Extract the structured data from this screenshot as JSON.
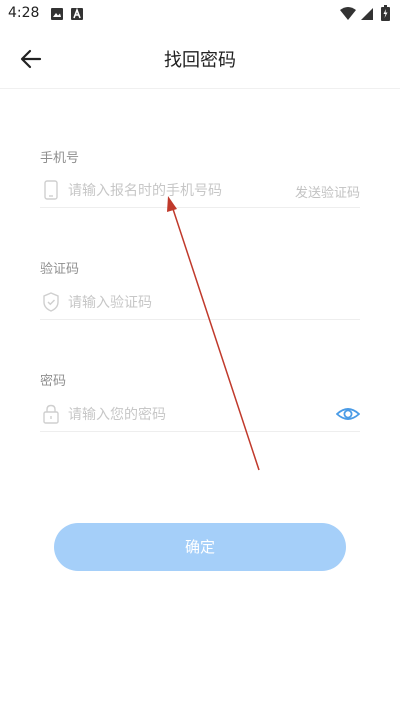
{
  "status_bar": {
    "time": "4:28"
  },
  "header": {
    "title": "找回密码"
  },
  "form": {
    "phone": {
      "label": "手机号",
      "placeholder": "请输入报名时的手机号码",
      "send_code_label": "发送验证码"
    },
    "code": {
      "label": "验证码",
      "placeholder": "请输入验证码"
    },
    "password": {
      "label": "密码",
      "placeholder": "请输入您的密码"
    }
  },
  "confirm_label": "确定",
  "colors": {
    "accent": "#a5cff9",
    "eye_icon": "#4a9be6",
    "annotation_arrow": "#c0392b"
  }
}
